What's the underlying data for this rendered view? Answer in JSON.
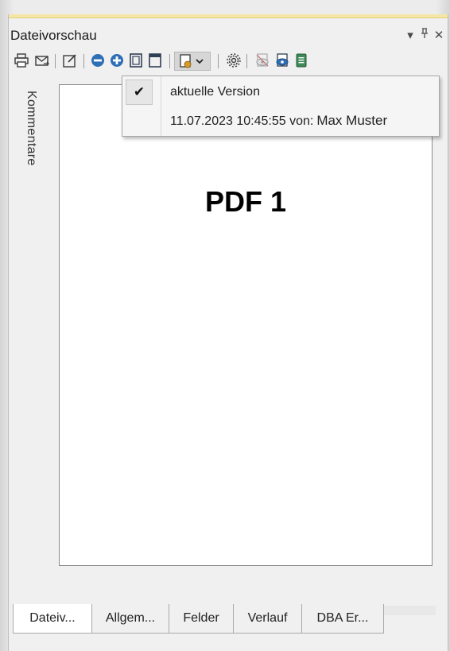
{
  "window": {
    "title": "Dateivorschau",
    "controls": {
      "menu_glyph": "▾",
      "pin_glyph": "⊥",
      "close_glyph": "✕"
    }
  },
  "toolbar": {
    "icons": [
      "print-icon",
      "send-mail-icon",
      "edit-icon",
      "zoom-out-icon",
      "zoom-in-icon",
      "fit-page-icon",
      "fit-width-icon",
      "version-dropdown-icon",
      "settings-icon",
      "hide-annotations-icon",
      "show-annotations-icon",
      "document-icon"
    ]
  },
  "sidebar": {
    "comments_tab_label": "Kommentare"
  },
  "document": {
    "content_title": "PDF 1"
  },
  "version_menu": {
    "check_glyph": "✔",
    "items": [
      {
        "label": "aktuelle Version",
        "checked": true
      },
      {
        "label": "11.07.2023 10:45:55 von:",
        "author": "Max Muster",
        "checked": false
      }
    ]
  },
  "bottom_tabs": [
    {
      "label": "Dateiv...",
      "active": true
    },
    {
      "label": "Allgem...",
      "active": false
    },
    {
      "label": "Felder",
      "active": false
    },
    {
      "label": "Verlauf",
      "active": false
    },
    {
      "label": "DBA Er...",
      "active": false
    }
  ],
  "colors": {
    "accent": "#f4e6a6",
    "panel": "#f0f0f0",
    "icon_blue": "#2f6fb5",
    "icon_dark": "#3a3a3a"
  }
}
